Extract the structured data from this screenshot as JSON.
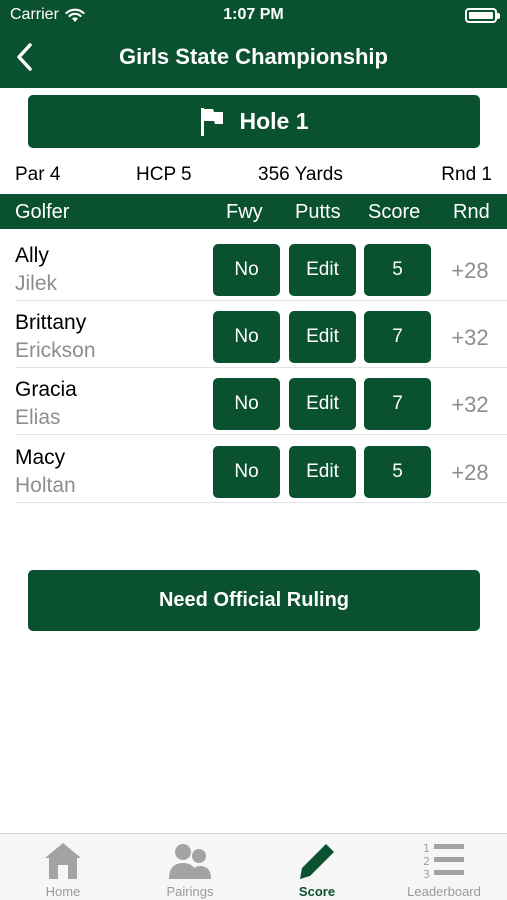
{
  "status": {
    "carrier": "Carrier",
    "time": "1:07 PM"
  },
  "nav": {
    "title": "Girls State Championship"
  },
  "hole": {
    "label": "Hole 1"
  },
  "info": {
    "par": "Par 4",
    "hcp": "HCP 5",
    "yards": "356 Yards",
    "round": "Rnd 1"
  },
  "columns": {
    "golfer": "Golfer",
    "fwy": "Fwy",
    "putts": "Putts",
    "score": "Score",
    "rnd": "Rnd"
  },
  "players": [
    {
      "first": "Ally",
      "last": "Jilek",
      "fwy": "No",
      "putts": "Edit",
      "score": "5",
      "rnd": "+28"
    },
    {
      "first": "Brittany",
      "last": "Erickson",
      "fwy": "No",
      "putts": "Edit",
      "score": "7",
      "rnd": "+32"
    },
    {
      "first": "Gracia",
      "last": "Elias",
      "fwy": "No",
      "putts": "Edit",
      "score": "7",
      "rnd": "+32"
    },
    {
      "first": "Macy",
      "last": "Holtan",
      "fwy": "No",
      "putts": "Edit",
      "score": "5",
      "rnd": "+28"
    }
  ],
  "ruling_button": "Need Official Ruling",
  "tabs": [
    {
      "label": "Home",
      "icon": "home-icon"
    },
    {
      "label": "Pairings",
      "icon": "people-icon"
    },
    {
      "label": "Score",
      "icon": "pencil-icon"
    },
    {
      "label": "Leaderboard",
      "icon": "list-icon"
    }
  ],
  "colors": {
    "brand": "#0a5130",
    "muted": "#8e8e8e",
    "tab_inactive": "#9a9a9a"
  }
}
